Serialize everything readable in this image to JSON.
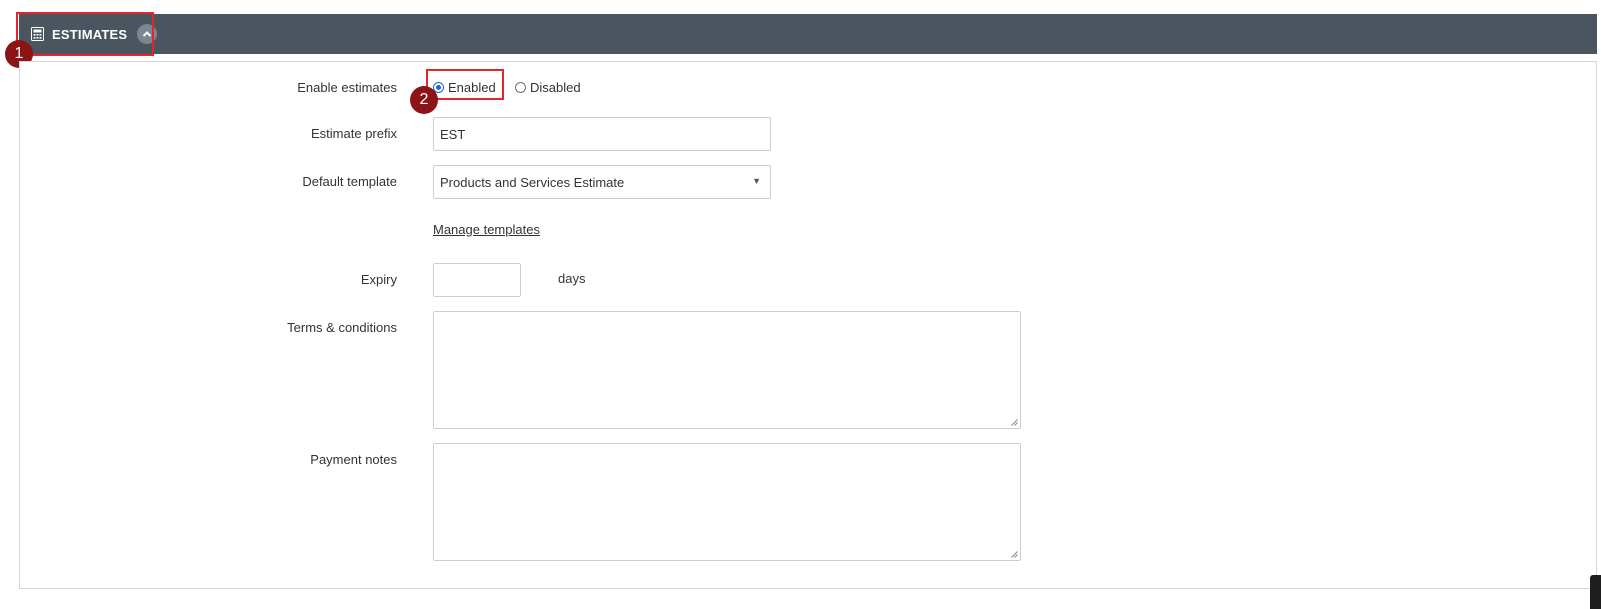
{
  "section": {
    "title": "ESTIMATES",
    "icon": "calculator-icon",
    "collapse_icon": "chevron-up-icon"
  },
  "callouts": [
    "1",
    "2"
  ],
  "form": {
    "enable_estimates": {
      "label": "Enable estimates",
      "options": [
        {
          "label": "Enabled",
          "checked": true
        },
        {
          "label": "Disabled",
          "checked": false
        }
      ]
    },
    "estimate_prefix": {
      "label": "Estimate prefix",
      "value": "EST"
    },
    "default_template": {
      "label": "Default template",
      "value": "Products and Services Estimate"
    },
    "manage_templates": "Manage templates",
    "expiry": {
      "label": "Expiry",
      "value": "",
      "unit": "days"
    },
    "terms": {
      "label": "Terms & conditions",
      "value": ""
    },
    "payment_notes": {
      "label": "Payment notes",
      "value": ""
    }
  },
  "colors": {
    "header_bg": "#4a5560",
    "callout_border": "#e3262b",
    "callout_badge": "#8b1416",
    "radio_accent": "#1a66d2"
  }
}
